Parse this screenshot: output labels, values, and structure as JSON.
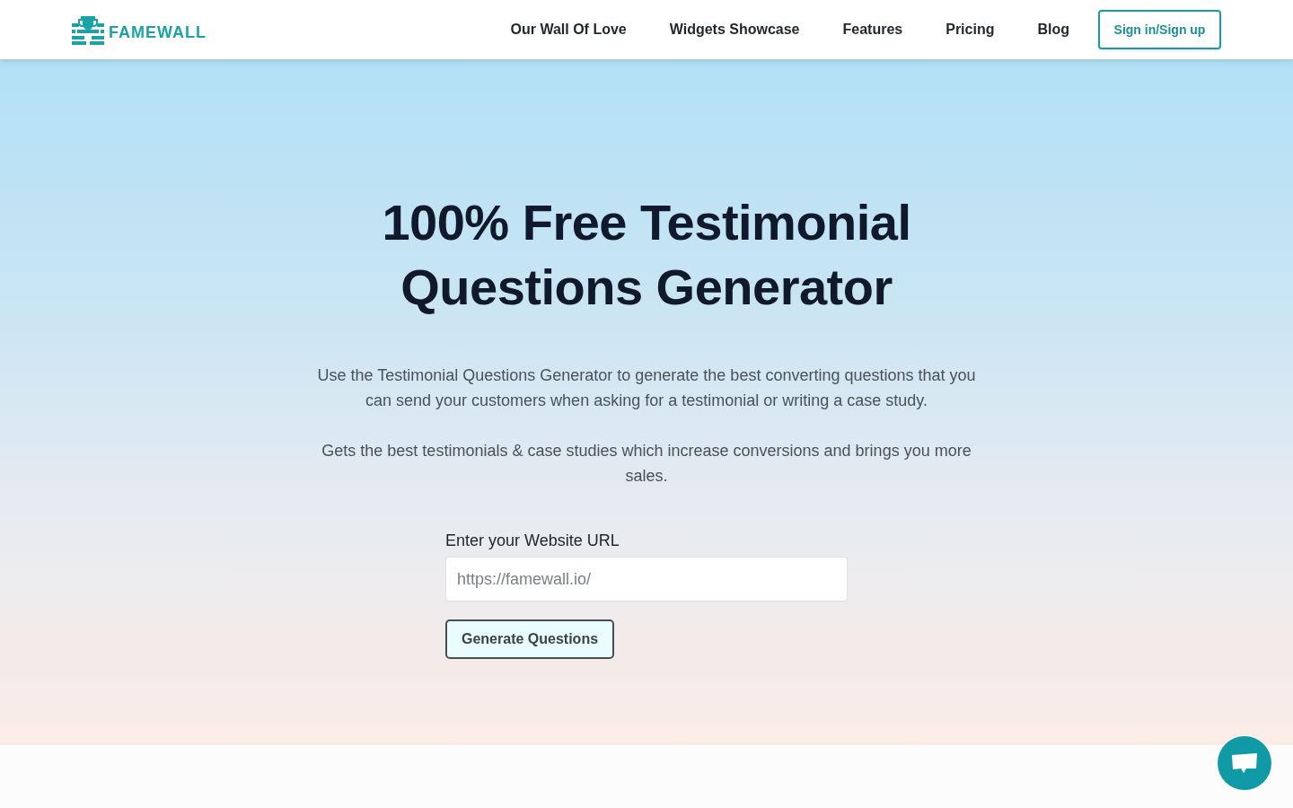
{
  "header": {
    "logo": {
      "text": "FAMEWALL"
    },
    "nav": [
      {
        "label": "Our Wall Of Love"
      },
      {
        "label": "Widgets Showcase"
      },
      {
        "label": "Features"
      },
      {
        "label": "Pricing"
      },
      {
        "label": "Blog"
      }
    ],
    "sign_in_button": "Sign in/Sign up"
  },
  "hero": {
    "title": "100% Free Testimonial Questions Generator",
    "paragraphs": [
      "Use the Testimonial Questions Generator to generate the best converting questions that you can send your customers when asking for a testimonial or writing a case study.",
      "Gets the best testimonials & case studies which increase conversions and brings you more sales."
    ],
    "form": {
      "label": "Enter your Website URL",
      "url_field": {
        "placeholder": "https://famewall.io/"
      },
      "submit_button": "Generate Questions"
    }
  }
}
